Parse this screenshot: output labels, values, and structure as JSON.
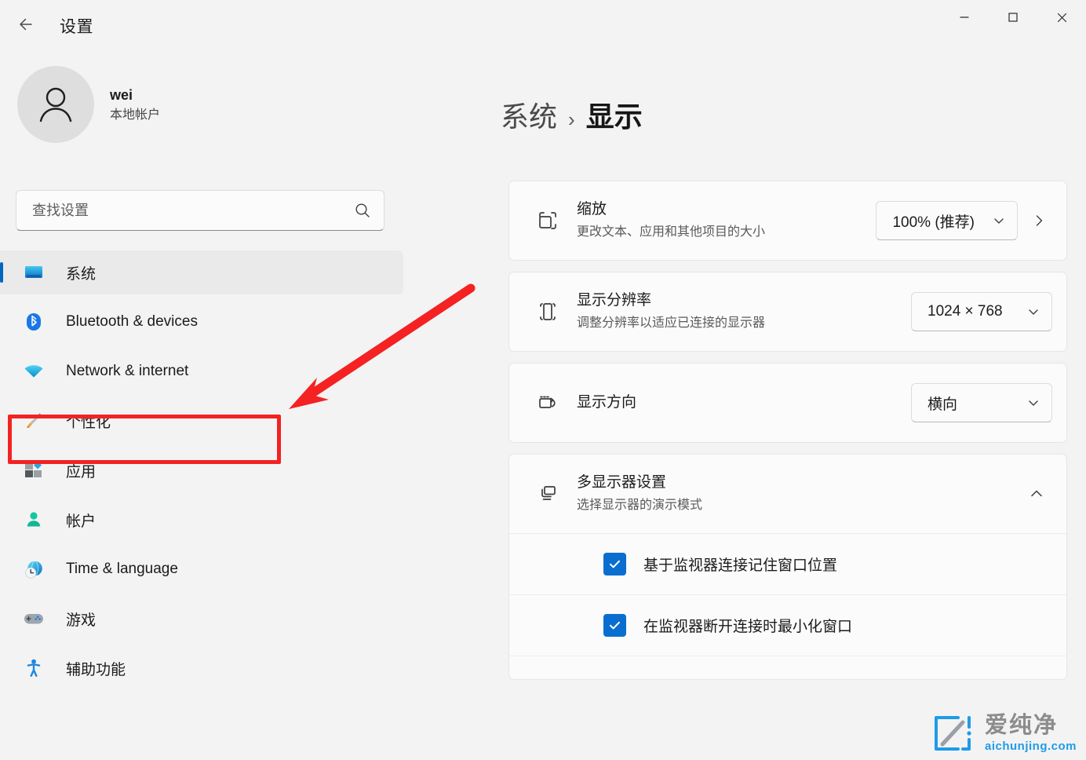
{
  "window": {
    "title": "设置",
    "back_icon": "back-arrow-icon",
    "controls": [
      {
        "name": "minimize-button",
        "icon": "minimize-icon",
        "label": "—"
      },
      {
        "name": "maximize-button",
        "icon": "maximize-icon",
        "label": "□"
      },
      {
        "name": "close-button",
        "icon": "close-icon",
        "label": "✕"
      }
    ]
  },
  "sidebar": {
    "account": {
      "avatar_icon": "person-avatar-icon",
      "name": "wei",
      "subtitle": "本地帐户"
    },
    "search": {
      "placeholder": "查找设置",
      "value": "",
      "icon": "search-icon"
    },
    "items": [
      {
        "label": "系统",
        "icon": "system-monitor-icon",
        "selected": true
      },
      {
        "label": "Bluetooth & devices",
        "icon": "bluetooth-icon",
        "selected": false
      },
      {
        "label": "Network & internet",
        "icon": "wifi-icon",
        "selected": false
      },
      {
        "label": "个性化",
        "icon": "paintbrush-icon",
        "selected": false
      },
      {
        "label": "应用",
        "icon": "apps-grid-icon",
        "selected": false
      },
      {
        "label": "帐户",
        "icon": "account-person-icon",
        "selected": false
      },
      {
        "label": "Time & language",
        "icon": "clock-globe-icon",
        "selected": false
      },
      {
        "label": "游戏",
        "icon": "gamepad-icon",
        "selected": false
      },
      {
        "label": "辅助功能",
        "icon": "accessibility-person-icon",
        "selected": false
      }
    ]
  },
  "main": {
    "breadcrumb": {
      "parent": "系统",
      "separator": "›",
      "current": "显示"
    },
    "cards": [
      {
        "name": "scale-card",
        "icon": "scale-resize-icon",
        "title": "缩放",
        "description": "更改文本、应用和其他项目的大小",
        "control": {
          "type": "combobox",
          "value": "100% (推荐)",
          "chevron": "chevron-down-icon"
        },
        "has_chevron_right": true,
        "chevron_right_icon": "chevron-right-icon"
      },
      {
        "name": "resolution-card",
        "icon": "display-resolution-icon",
        "title": "显示分辨率",
        "description": "调整分辨率以适应已连接的显示器",
        "control": {
          "type": "combobox",
          "value": "1024 × 768",
          "chevron": "chevron-down-icon"
        },
        "has_chevron_right": false
      },
      {
        "name": "orientation-card",
        "icon": "display-orientation-icon",
        "title": "显示方向",
        "description": "",
        "control": {
          "type": "combobox",
          "value": "横向",
          "chevron": "chevron-down-icon"
        },
        "has_chevron_right": false
      }
    ],
    "multi_monitor": {
      "name": "multi-monitor-card",
      "icon": "multi-monitor-icon",
      "title": "多显示器设置",
      "description": "选择显示器的演示模式",
      "expander_icon": "chevron-up-icon",
      "expanded": true,
      "options": [
        {
          "label": "基于监视器连接记住窗口位置",
          "checked": true
        },
        {
          "label": "在监视器断开连接时最小化窗口",
          "checked": true
        }
      ]
    }
  },
  "annotations": {
    "highlight_rect": {
      "name": "personalization-highlight",
      "color": "#f42222"
    },
    "arrow": {
      "name": "pointer-arrow",
      "color": "#f42222",
      "points_to": "个性化"
    }
  },
  "watermark": {
    "logo_icon": "aichunjing-logo-icon",
    "cn_text": "爱纯净",
    "en_text": "aichunjing.com",
    "cn_color": "#8c8c8c",
    "en_color": "#1f9be8"
  },
  "colors": {
    "window_bg": "#f3f3f3",
    "card_bg": "#fbfbfb",
    "accent": "#0067c0",
    "checkbox": "#0a6ed1",
    "annotation": "#f42222"
  }
}
